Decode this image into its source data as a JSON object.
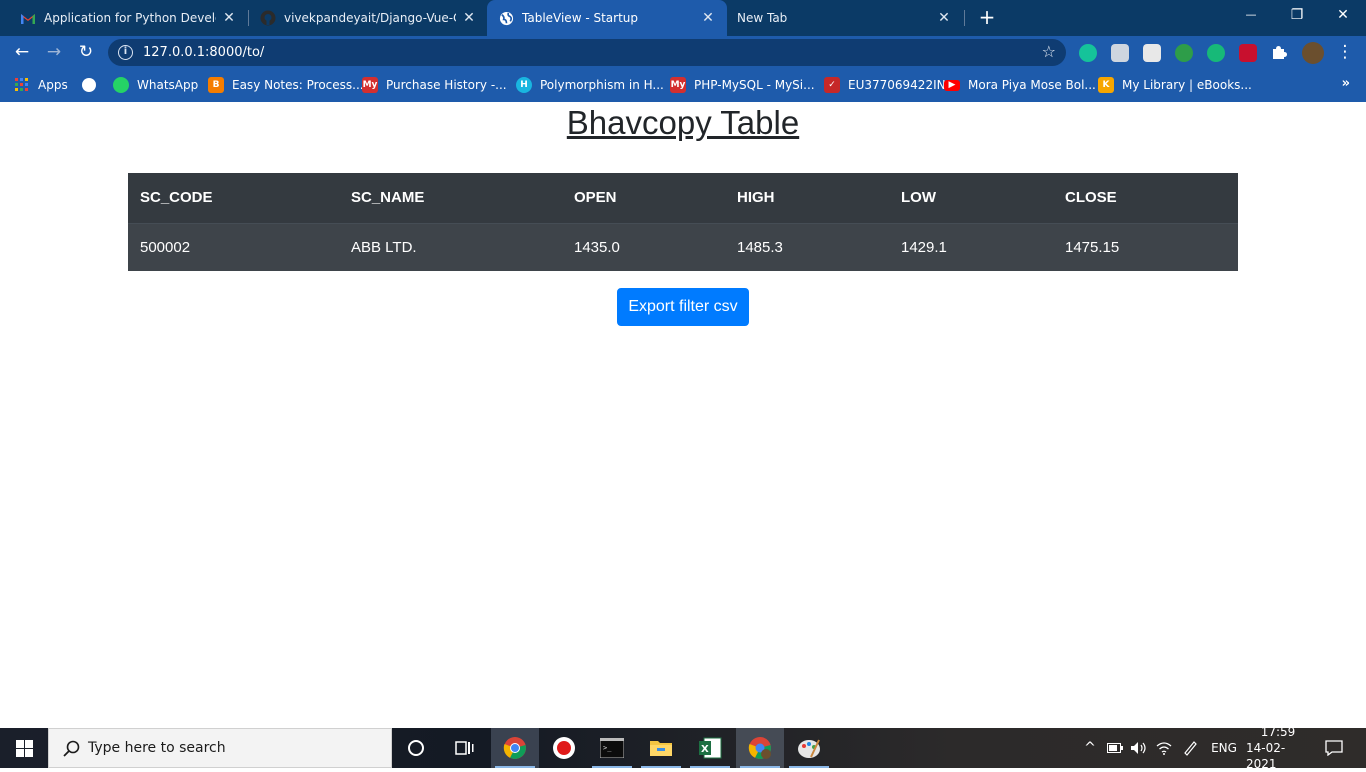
{
  "browser": {
    "tabs": [
      {
        "title": "Application for Python Developer",
        "icon": "gmail-icon",
        "active": false
      },
      {
        "title": "vivekpandeyait/Django-Vue-CSV",
        "icon": "github-icon",
        "active": false
      },
      {
        "title": "TableView - Startup",
        "icon": "globe-icon",
        "active": true
      },
      {
        "title": "New Tab",
        "icon": "",
        "active": false
      }
    ],
    "close_glyph": "✕",
    "newtab_glyph": "+",
    "window_controls": {
      "minimize": "—",
      "restore": "❐",
      "close": "✕"
    },
    "nav": {
      "back": "←",
      "forward": "→",
      "reload": "↻"
    },
    "url": "127.0.0.1:8000/to/",
    "info_glyph": "i",
    "star_glyph": "☆",
    "menu_glyph": "⋮"
  },
  "bookmarks": {
    "items": [
      {
        "label": "Apps",
        "icon": "apps-grid-icon",
        "color": "#4285f4"
      },
      {
        "label": "",
        "icon": "globe-icon",
        "color": "#ffffff"
      },
      {
        "label": "WhatsApp",
        "icon": "whatsapp-icon",
        "color": "#25d366"
      },
      {
        "label": "Easy Notes: Process...",
        "icon": "blogger-icon",
        "color": "#f57d00"
      },
      {
        "label": "Purchase History -...",
        "icon": "my-icon",
        "color": "#d32f2f"
      },
      {
        "label": "Polymorphism in H...",
        "icon": "hackerrank-icon",
        "color": "#19b6e0"
      },
      {
        "label": "PHP-MySQL - MySi...",
        "icon": "my-icon",
        "color": "#d32f2f"
      },
      {
        "label": "EU377069422IN",
        "icon": "indiapost-icon",
        "color": "#c62828"
      },
      {
        "label": "Mora Piya Mose Bol...",
        "icon": "youtube-icon",
        "color": "#ff0000"
      },
      {
        "label": "My Library | eBooks...",
        "icon": "kindle-icon",
        "color": "#f7a600"
      }
    ],
    "overflow": "»"
  },
  "page": {
    "heading": "Bhavcopy Table",
    "table": {
      "headers": [
        "SC_CODE",
        "SC_NAME",
        "OPEN",
        "HIGH",
        "LOW",
        "CLOSE"
      ],
      "rows": [
        [
          "500002",
          "ABB LTD.",
          "1435.0",
          "1485.3",
          "1429.1",
          "1475.15"
        ]
      ]
    },
    "export_button": "Export filter csv"
  },
  "taskbar": {
    "search_placeholder": "Type here to search",
    "language": "ENG",
    "time": "17:59",
    "date": "14-02-2021",
    "chevron": "^"
  }
}
